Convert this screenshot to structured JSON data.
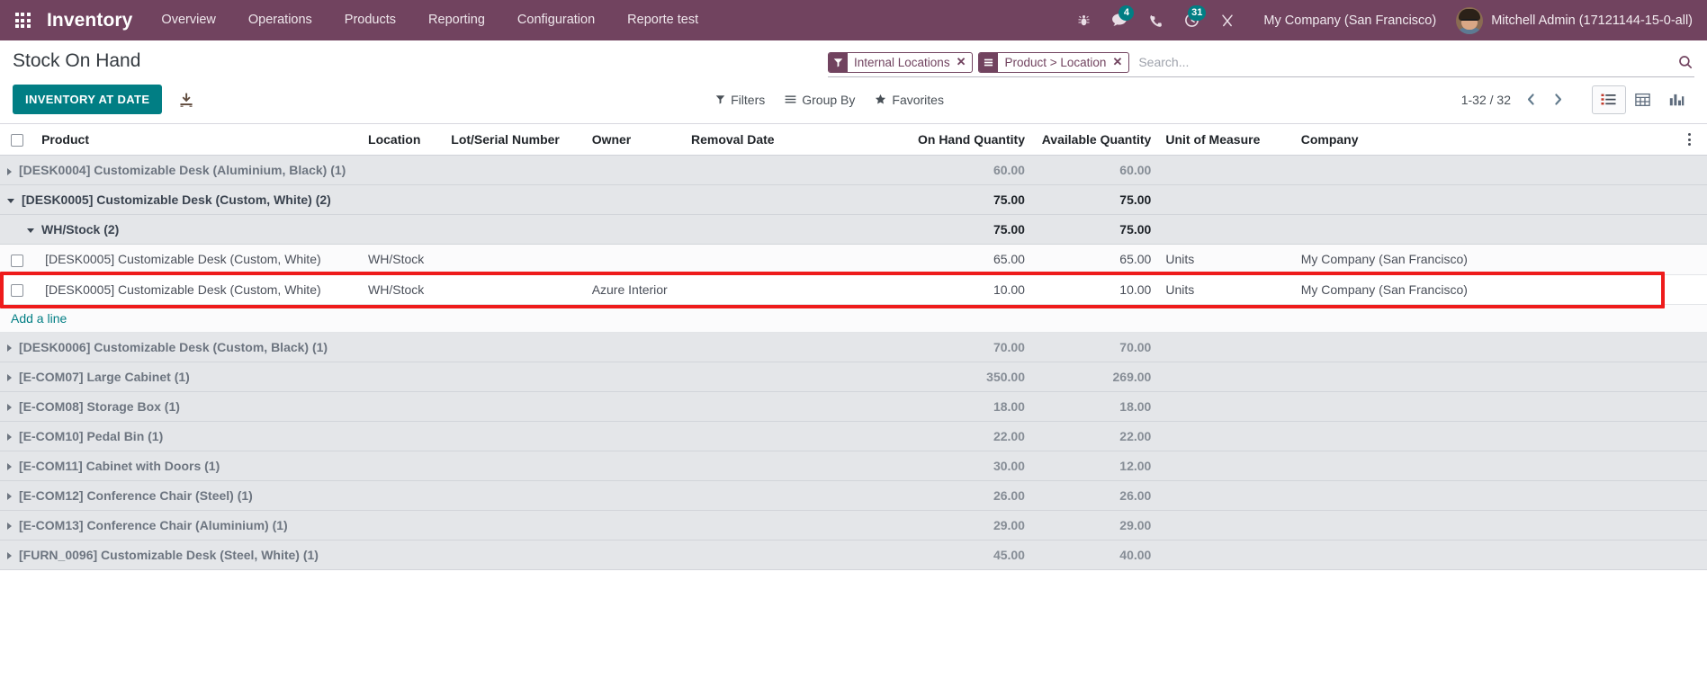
{
  "navbar": {
    "apps_icon": "apps-grid-icon",
    "brand": "Inventory",
    "menu": [
      {
        "label": "Overview"
      },
      {
        "label": "Operations"
      },
      {
        "label": "Products"
      },
      {
        "label": "Reporting"
      },
      {
        "label": "Configuration"
      },
      {
        "label": "Reporte test"
      }
    ],
    "systray": [
      {
        "name": "debug-bug-icon",
        "icon": "bug",
        "badge": null
      },
      {
        "name": "messaging-icon",
        "icon": "chat",
        "badge": "4"
      },
      {
        "name": "voip-phone-icon",
        "icon": "phone",
        "badge": null
      },
      {
        "name": "activities-clock-icon",
        "icon": "clock",
        "badge": "31"
      },
      {
        "name": "shortcut-icon",
        "icon": "scissors",
        "badge": null
      }
    ],
    "company": "My Company (San Francisco)",
    "user": "Mitchell Admin (17121144-15-0-all)",
    "brand_color": "#71435f"
  },
  "control_panel": {
    "title": "Stock On Hand",
    "primary_button": "INVENTORY AT DATE",
    "primary_button_color": "#017e84",
    "import_icon": "import-download-icon",
    "search": {
      "placeholder": "Search...",
      "magnifier_icon": "search-icon",
      "facets": [
        {
          "icon": "filter-funnel-icon",
          "label": "Internal Locations",
          "remove_icon": "close-icon"
        },
        {
          "icon": "groupby-list-icon",
          "label": "Product > Location",
          "remove_icon": "close-icon"
        }
      ]
    },
    "dropdowns": [
      {
        "name": "filters",
        "icon": "filter-funnel-icon",
        "label": "Filters"
      },
      {
        "name": "group-by",
        "icon": "groupby-bars-icon",
        "label": "Group By"
      },
      {
        "name": "favorites",
        "icon": "star-icon",
        "label": "Favorites"
      }
    ],
    "pager": {
      "value": "1-32 / 32",
      "prev_icon": "chevron-left-icon",
      "next_icon": "chevron-right-icon"
    },
    "views": [
      {
        "name": "list",
        "icon": "list-view-icon",
        "active": true
      },
      {
        "name": "pivot",
        "icon": "pivot-table-icon",
        "active": false
      },
      {
        "name": "graph",
        "icon": "bar-chart-icon",
        "active": false
      }
    ]
  },
  "table": {
    "columns": [
      {
        "key": "check",
        "label": "",
        "align": "left"
      },
      {
        "key": "product",
        "label": "Product",
        "align": "left"
      },
      {
        "key": "location",
        "label": "Location",
        "align": "left"
      },
      {
        "key": "lot",
        "label": "Lot/Serial Number",
        "align": "left"
      },
      {
        "key": "owner",
        "label": "Owner",
        "align": "left"
      },
      {
        "key": "removal",
        "label": "Removal Date",
        "align": "left"
      },
      {
        "key": "onhand",
        "label": "On Hand Quantity",
        "align": "right"
      },
      {
        "key": "available",
        "label": "Available Quantity",
        "align": "right"
      },
      {
        "key": "uom",
        "label": "Unit of Measure",
        "align": "left"
      },
      {
        "key": "company",
        "label": "Company",
        "align": "left"
      },
      {
        "key": "options",
        "label": "",
        "align": "right"
      }
    ],
    "optional_columns_icon": "vertical-dots-icon",
    "rows": [
      {
        "type": "group",
        "expanded": false,
        "indent": 0,
        "label": "[DESK0004] Customizable Desk (Aluminium, Black) (1)",
        "onhand": "60.00",
        "available": "60.00"
      },
      {
        "type": "group",
        "expanded": true,
        "indent": 0,
        "label": "[DESK0005] Customizable Desk (Custom, White) (2)",
        "onhand": "75.00",
        "available": "75.00"
      },
      {
        "type": "group",
        "expanded": true,
        "indent": 1,
        "label": "WH/Stock (2)",
        "onhand": "75.00",
        "available": "75.00"
      },
      {
        "type": "data",
        "selected": false,
        "product": "[DESK0005] Customizable Desk (Custom, White)",
        "location": "WH/Stock",
        "lot": "",
        "owner": "",
        "removal": "",
        "onhand": "65.00",
        "available": "65.00",
        "uom": "Units",
        "company": "My Company (San Francisco)"
      },
      {
        "type": "data",
        "selected": true,
        "product": "[DESK0005] Customizable Desk (Custom, White)",
        "location": "WH/Stock",
        "lot": "",
        "owner": "Azure Interior",
        "removal": "",
        "onhand": "10.00",
        "available": "10.00",
        "uom": "Units",
        "company": "My Company (San Francisco)"
      },
      {
        "type": "add",
        "label": "Add a line"
      },
      {
        "type": "group",
        "expanded": false,
        "indent": 0,
        "label": "[DESK0006] Customizable Desk (Custom, Black) (1)",
        "onhand": "70.00",
        "available": "70.00"
      },
      {
        "type": "group",
        "expanded": false,
        "indent": 0,
        "label": "[E-COM07] Large Cabinet (1)",
        "onhand": "350.00",
        "available": "269.00"
      },
      {
        "type": "group",
        "expanded": false,
        "indent": 0,
        "label": "[E-COM08] Storage Box (1)",
        "onhand": "18.00",
        "available": "18.00"
      },
      {
        "type": "group",
        "expanded": false,
        "indent": 0,
        "label": "[E-COM10] Pedal Bin (1)",
        "onhand": "22.00",
        "available": "22.00"
      },
      {
        "type": "group",
        "expanded": false,
        "indent": 0,
        "label": "[E-COM11] Cabinet with Doors (1)",
        "onhand": "30.00",
        "available": "12.00"
      },
      {
        "type": "group",
        "expanded": false,
        "indent": 0,
        "label": "[E-COM12] Conference Chair (Steel) (1)",
        "onhand": "26.00",
        "available": "26.00"
      },
      {
        "type": "group",
        "expanded": false,
        "indent": 0,
        "label": "[E-COM13] Conference Chair (Aluminium) (1)",
        "onhand": "29.00",
        "available": "29.00"
      },
      {
        "type": "group",
        "expanded": false,
        "indent": 0,
        "label": "[FURN_0096] Customizable Desk (Steel, White) (1)",
        "onhand": "45.00",
        "available": "40.00"
      }
    ]
  },
  "annotation": {
    "highlight_color": "#ee1b1b",
    "target_row_index": 4
  }
}
